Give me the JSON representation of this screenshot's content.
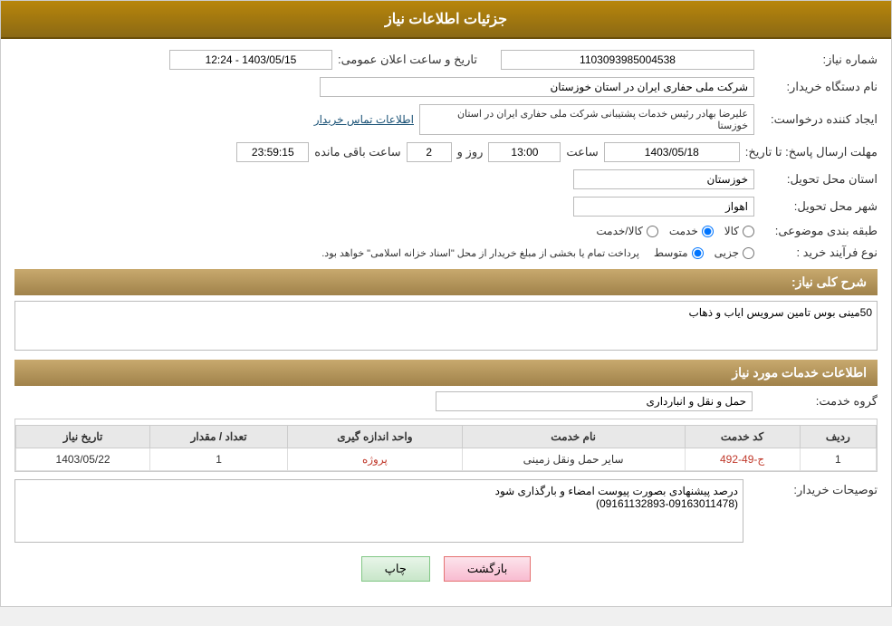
{
  "page": {
    "title": "جزئیات اطلاعات نیاز"
  },
  "header": {
    "need_number_label": "شماره نیاز:",
    "need_number_value": "1103093985004538",
    "announce_datetime_label": "تاریخ و ساعت اعلان عمومی:",
    "announce_datetime_value": "1403/05/15 - 12:24",
    "buyer_org_label": "نام دستگاه خریدار:",
    "buyer_org_value": "شرکت ملی حفاری ایران در استان خوزستان",
    "requester_label": "ایجاد کننده درخواست:",
    "requester_value": "علیرضا بهادر رئیس خدمات پشتیبانی شرکت ملی حفاری ایران در استان خوزستا",
    "contact_link": "اطلاعات تماس خریدار",
    "deadline_label": "مهلت ارسال پاسخ: تا تاریخ:",
    "deadline_date": "1403/05/18",
    "deadline_time_label": "ساعت",
    "deadline_time": "13:00",
    "days_label": "روز و",
    "days_value": "2",
    "remaining_label": "ساعت باقی مانده",
    "remaining_time": "23:59:15",
    "province_label": "استان محل تحویل:",
    "province_value": "خوزستان",
    "city_label": "شهر محل تحویل:",
    "city_value": "اهواز",
    "category_label": "طبقه بندی موضوعی:",
    "category_options": [
      {
        "id": "kala",
        "label": "کالا",
        "checked": false
      },
      {
        "id": "khadamat",
        "label": "خدمت",
        "checked": true
      },
      {
        "id": "kala_khadamat",
        "label": "کالا/خدمت",
        "checked": false
      }
    ],
    "purchase_type_label": "نوع فرآیند خرید :",
    "purchase_type_options": [
      {
        "id": "jozii",
        "label": "جزیی",
        "checked": false
      },
      {
        "id": "motevasset",
        "label": "متوسط",
        "checked": true
      }
    ],
    "purchase_type_description": "پرداخت تمام یا بخشی از مبلغ خریدار از محل \"اسناد خزانه اسلامی\" خواهد بود.",
    "need_description_label": "شرح کلی نیاز:",
    "need_description_value": "50مینی بوس تامین سرویس ایاب و ذهاب"
  },
  "services_section": {
    "title": "اطلاعات خدمات مورد نیاز",
    "service_group_label": "گروه خدمت:",
    "service_group_value": "حمل و نقل و انبارداری",
    "table": {
      "columns": [
        "ردیف",
        "کد خدمت",
        "نام خدمت",
        "واحد اندازه گیری",
        "تعداد / مقدار",
        "تاریخ نیاز"
      ],
      "rows": [
        {
          "row_num": "1",
          "service_code": "ج-49-492",
          "service_name": "سایر حمل ونقل زمینی",
          "unit": "پروژه",
          "quantity": "1",
          "date": "1403/05/22"
        }
      ]
    }
  },
  "buyer_notes_section": {
    "label": "توصیحات خریدار:",
    "notes_text": "درصد پیشنهادی بصورت پیوست امضاء و بارگذاری شود\n(09161132893-09163011478)"
  },
  "buttons": {
    "print_label": "چاپ",
    "back_label": "بازگشت"
  }
}
